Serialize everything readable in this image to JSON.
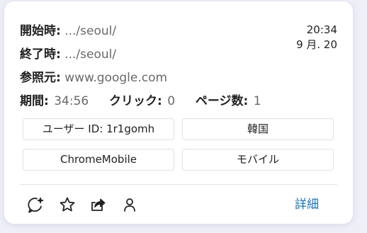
{
  "session": {
    "start_label": "開始時:",
    "start_value": ".../seoul/",
    "end_label": "終了時:",
    "end_value": ".../seoul/",
    "referrer_label": "参照元:",
    "referrer_value": "www.google.com"
  },
  "stats": {
    "duration_label": "期間:",
    "duration_value": "34:56",
    "clicks_label": "クリック:",
    "clicks_value": "0",
    "pages_label": "ページ数:",
    "pages_value": "1"
  },
  "time": {
    "clock": "20:34",
    "date": "9 月. 20"
  },
  "tags": {
    "user_id": "ユーザー ID: 1r1gomh",
    "country": "韓国",
    "browser": "ChromeMobile",
    "device": "モバイル"
  },
  "actions": {
    "icons": [
      "chat-sparkle-icon",
      "star-icon",
      "share-icon",
      "user-icon"
    ],
    "details_label": "詳細"
  },
  "colors": {
    "link": "#1b74b8",
    "background": "#efeff8",
    "card": "#ffffff"
  }
}
